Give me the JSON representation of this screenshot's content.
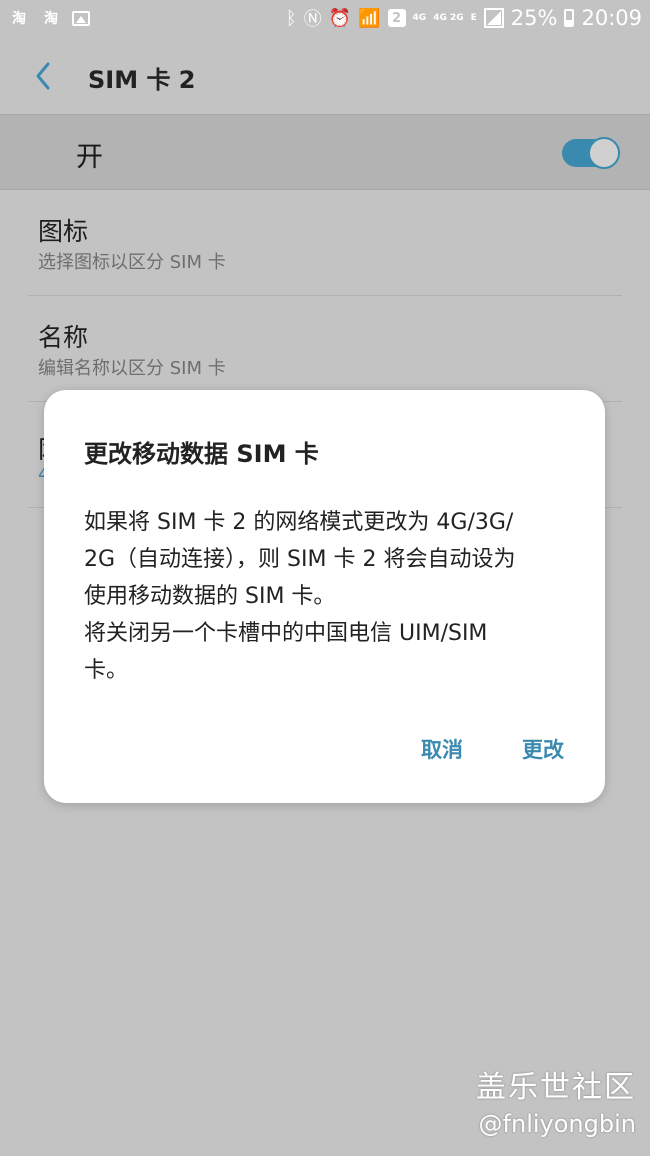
{
  "status_bar": {
    "app_icon_1": "淘",
    "app_icon_2": "淘",
    "network_4g": "4G",
    "network_4g2g": "4G 2G",
    "network_e": "E",
    "sim_slot": "2",
    "battery": "25%",
    "time": "20:09"
  },
  "app_bar": {
    "title": "SIM 卡 2"
  },
  "master_switch": {
    "label": "开",
    "on": true
  },
  "settings": {
    "icon": {
      "title": "图标",
      "subtitle": "选择图标以区分 SIM 卡"
    },
    "name": {
      "title": "名称",
      "subtitle": "编辑名称以区分 SIM 卡"
    },
    "hidden_item": {
      "title_fragment": "网",
      "subtitle_fragment": "4"
    }
  },
  "dialog": {
    "title": "更改移动数据 SIM 卡",
    "body_lines": [
      "如果将 SIM 卡 2 的网络模式更改为 4G/3G/",
      "2G（自动连接），则 SIM 卡 2 将会自动设为",
      "使用移动数据的 SIM 卡。",
      "将关闭另一个卡槽中的中国电信 UIM/SIM",
      "卡。"
    ],
    "cancel_label": "取消",
    "confirm_label": "更改"
  },
  "watermark": {
    "site": "盖乐世社区",
    "user": "@fnliyongbin"
  },
  "colors": {
    "accent": "#3a8ab0",
    "background_dimmed": "#c3c3c3",
    "dialog_bg": "#ffffff"
  }
}
